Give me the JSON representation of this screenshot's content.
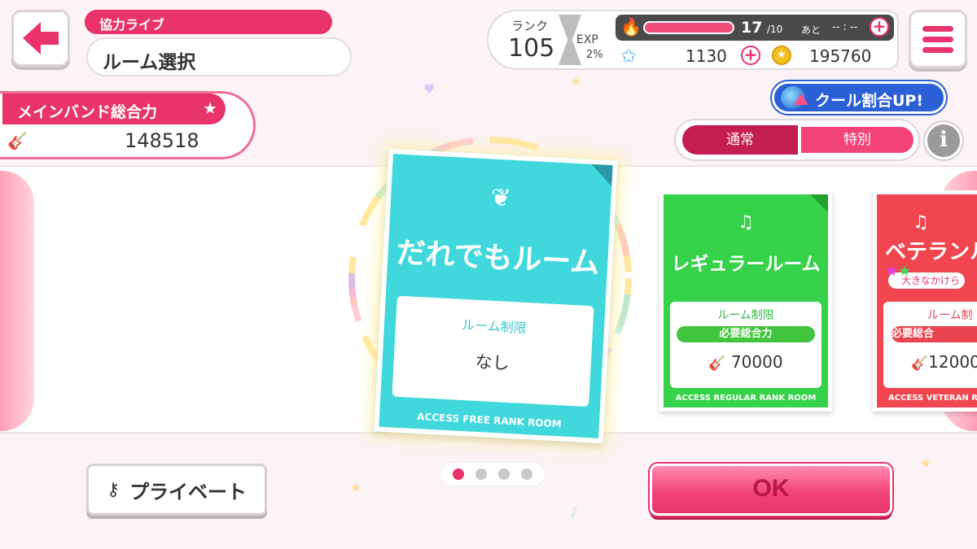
{
  "header": {
    "category": "協力ライブ",
    "title": "ルーム選択"
  },
  "status": {
    "rank_label": "ランク",
    "rank_value": "105",
    "exp_label": "EXP",
    "exp_value": "2%",
    "stamina_current": "17",
    "stamina_max": "/10",
    "stamina_ato": "あと",
    "stamina_time": "-- : --",
    "stamina_fill": 1.0,
    "gems": "1130",
    "coins": "195760"
  },
  "band": {
    "label": "メインバンド総合力",
    "value": "148518"
  },
  "cool_badge": "クール割合UP!",
  "toggle": {
    "normal": "通常",
    "special": "特別",
    "info": "i"
  },
  "rooms": [
    {
      "title": "だれでもルーム",
      "restriction_label": "ルーム制限",
      "restriction_value": "なし",
      "footer": "ACCESS FREE RANK ROOM"
    },
    {
      "title": "レギュラールーム",
      "restriction_label": "ルーム制限",
      "requirement": "必要総合力",
      "value": "70000",
      "footer": "ACCESS REGULAR RANK ROOM"
    },
    {
      "title": "ベテランル",
      "tag": "大きなかけら",
      "restriction_label": "ルーム制",
      "requirement": "必要総合",
      "value": "12000",
      "footer": "ACCESS VETERAN R"
    }
  ],
  "pagination": {
    "total": 4,
    "active": 1
  },
  "buttons": {
    "private": "プライベート",
    "ok": "OK"
  },
  "colors": {
    "accent": "#e8346a",
    "free_room": "#40d8dc",
    "regular_room": "#35d24a",
    "veteran_room": "#f1464f",
    "cool_badge": "#2b5fd6"
  }
}
